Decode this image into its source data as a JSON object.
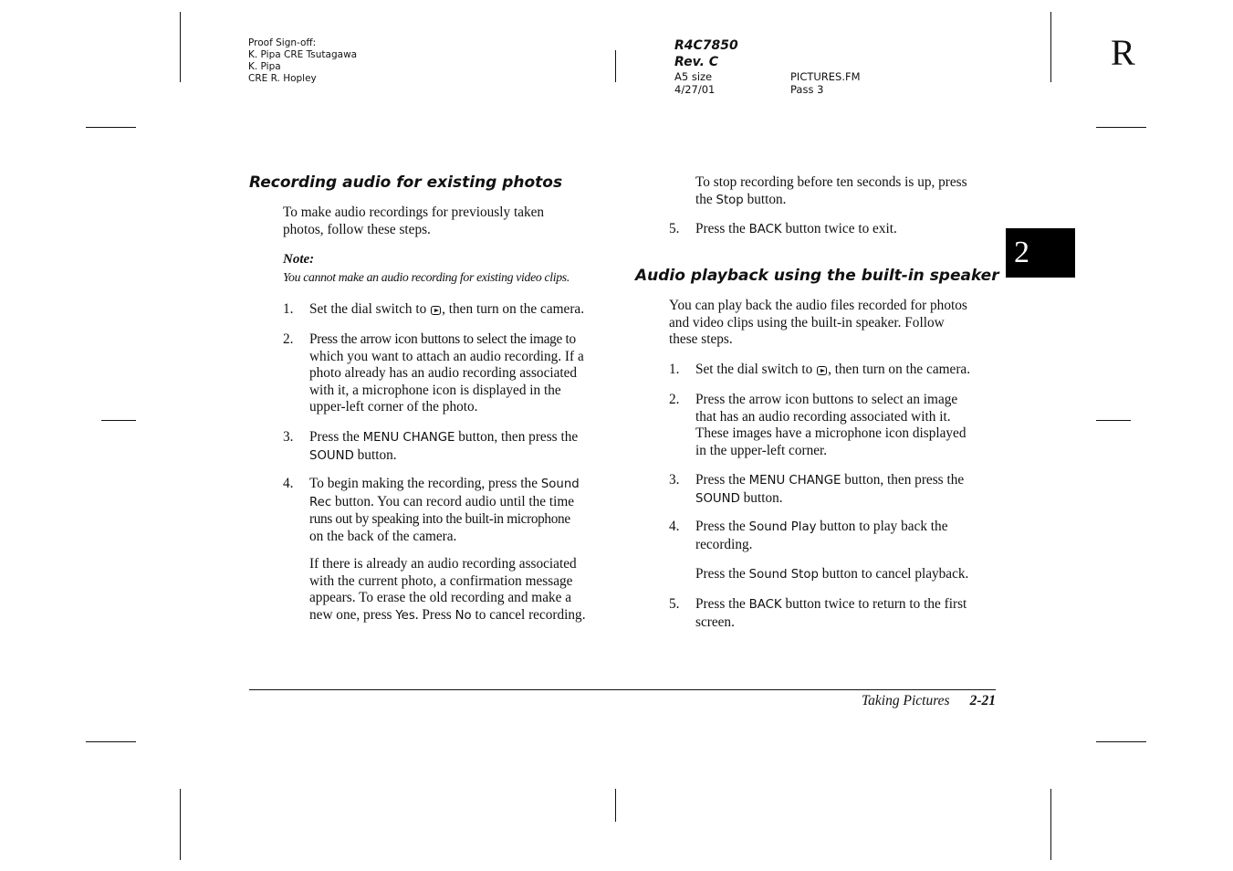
{
  "header": {
    "proof_signoff": {
      "label": "Proof Sign-off:",
      "lines": [
        "K. Pipa CRE Tsutagawa",
        "K. Pipa",
        "CRE R. Hopley"
      ]
    },
    "doc_code": "R4C7850",
    "revision": "Rev. C",
    "size": "A5 size",
    "filename": "PICTURES.FM",
    "date": "4/27/01",
    "pass": "Pass 3",
    "corner_mark": "R"
  },
  "chapter_tab": "2",
  "left_column": {
    "heading": "Recording audio for existing photos",
    "intro": [
      "To make audio recordings for previously taken",
      "photos, follow these steps."
    ],
    "note_label": "Note:",
    "note_text": "You cannot make an audio recording for existing video clips.",
    "steps": [
      {
        "num": "1.",
        "pre": "Set the dial switch to ",
        "icon": "playback-mode-icon",
        "post": ", then turn on the camera."
      },
      {
        "num": "2.",
        "lines": [
          "Press the arrow icon buttons to select the image to",
          "which you want to attach an audio recording. If a",
          "photo already has an audio recording associated",
          "with it, a microphone icon is displayed in the",
          "upper-left corner of the photo."
        ]
      },
      {
        "num": "3.",
        "l1a": "Press the ",
        "l1b": "MENU CHANGE",
        "l1c": " button, then press the",
        "l2a": "SOUND",
        "l2b": " button."
      },
      {
        "num": "4.",
        "l1a": "To begin making the recording, press the ",
        "l1b": "Sound",
        "l2a": "Rec",
        "l2b": " button. You can record audio until the time",
        "l3": "runs out by speaking into the built-in microphone",
        "l4": "on the back of the camera."
      }
    ],
    "step4_extra": {
      "l1": "If there is already an audio recording associated",
      "l2": "with the current photo, a confirmation message",
      "l3": "appears. To erase the old recording and make a",
      "l4a": "new one, press ",
      "l4b": "Yes",
      "l4c": ". Press ",
      "l4d": "No",
      "l4e": " to cancel recording."
    }
  },
  "right_column": {
    "cont_l1": "To stop recording before ten seconds is up, press",
    "cont_l2a": "the ",
    "cont_l2b": "Stop",
    "cont_l2c": " button.",
    "step5": {
      "num": "5.",
      "a": "Press the ",
      "b": "BACK",
      "c": " button twice to exit."
    },
    "heading": "Audio playback using the built-in speaker",
    "intro": [
      "You can play back the audio files recorded for photos",
      "and video clips using the built-in speaker. Follow",
      "these steps."
    ],
    "steps": [
      {
        "num": "1.",
        "pre": "Set the dial switch to ",
        "icon": "playback-mode-icon",
        "post": ", then turn on the camera."
      },
      {
        "num": "2.",
        "lines": [
          "Press the arrow icon buttons to select an image",
          "that has an audio recording associated with it.",
          "These images have a microphone icon displayed",
          "in the upper-left corner."
        ]
      },
      {
        "num": "3.",
        "l1a": "Press the ",
        "l1b": "MENU CHANGE",
        "l1c": " button, then press the",
        "l2a": "SOUND",
        "l2b": " button."
      },
      {
        "num": "4.",
        "l1a": "Press the ",
        "l1b": "Sound Play",
        "l1c": " button to play back the",
        "l2": "recording."
      },
      {
        "num": "5.",
        "l1a": "Press the ",
        "l1b": "BACK",
        "l1c": " button twice to return to the first",
        "l2": "screen."
      }
    ],
    "step4_extra": {
      "a": "Press the ",
      "b": "Sound Stop",
      "c": " button to cancel playback."
    }
  },
  "footer": {
    "section": "Taking Pictures",
    "page": "2-21"
  }
}
